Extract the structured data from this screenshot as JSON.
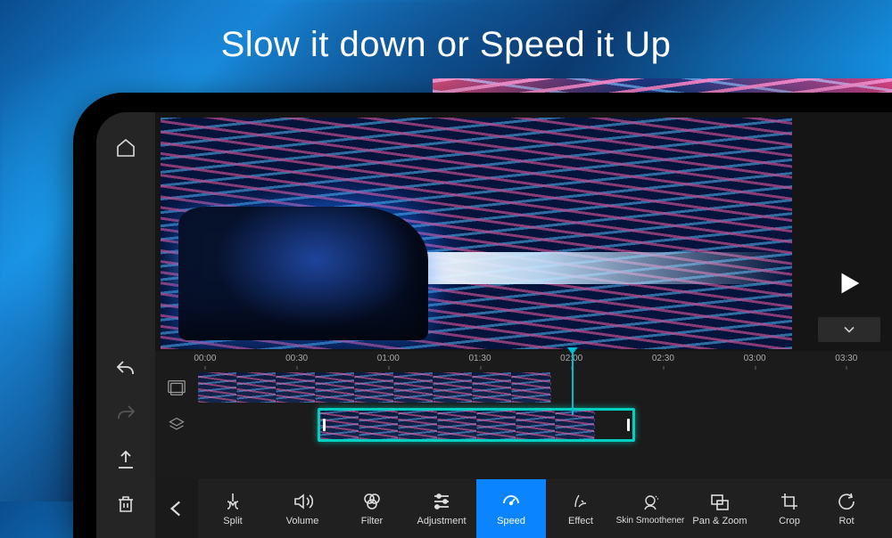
{
  "headline": "Slow it down or Speed it Up",
  "ruler": {
    "ticks": [
      "00:00",
      "00:30",
      "01:00",
      "01:30",
      "02:00",
      "02:30",
      "03:00",
      "03:30"
    ],
    "playhead_time": "02:00"
  },
  "tracks": {
    "video": {
      "clip_start": "00:00",
      "clip_end": "02:02"
    },
    "overlay": {
      "clip_start": "00:40",
      "clip_end": "02:22",
      "selected": true
    }
  },
  "tools": [
    {
      "id": "split",
      "label": "Split"
    },
    {
      "id": "volume",
      "label": "Volume"
    },
    {
      "id": "filter",
      "label": "Filter"
    },
    {
      "id": "adjustment",
      "label": "Adjustment"
    },
    {
      "id": "speed",
      "label": "Speed",
      "selected": true
    },
    {
      "id": "effect",
      "label": "Effect"
    },
    {
      "id": "skin",
      "label": "Skin Smoothener"
    },
    {
      "id": "panzoom",
      "label": "Pan & Zoom"
    },
    {
      "id": "crop",
      "label": "Crop"
    },
    {
      "id": "rotate",
      "label": "Rot"
    }
  ]
}
